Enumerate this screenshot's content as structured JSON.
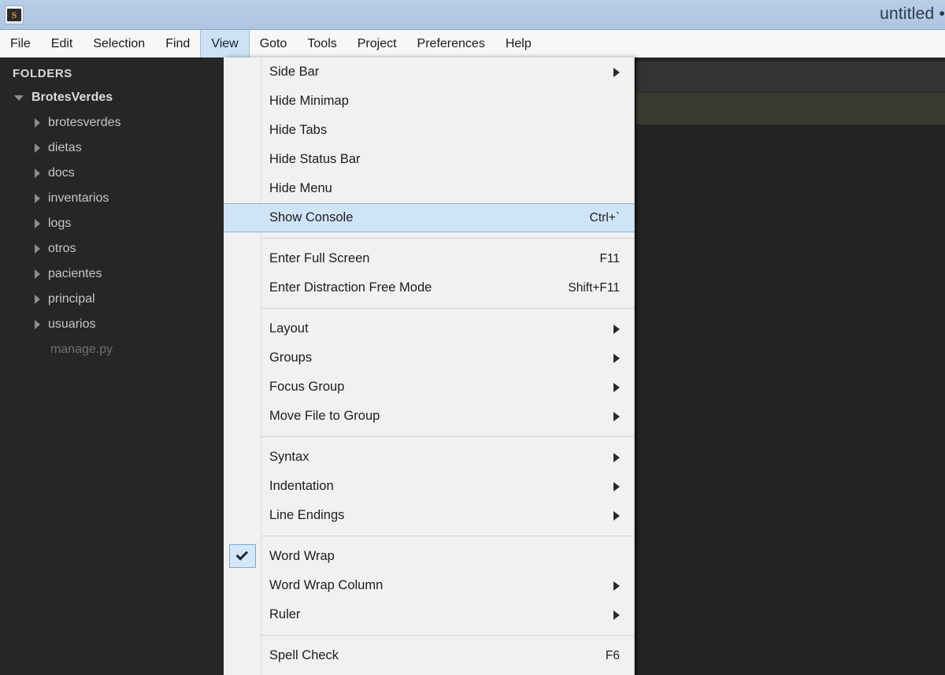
{
  "window": {
    "title": "untitled •",
    "app_icon": "sublime-text-icon",
    "icon_letter": "S"
  },
  "menubar": {
    "items": [
      {
        "label": "File",
        "active": false
      },
      {
        "label": "Edit",
        "active": false
      },
      {
        "label": "Selection",
        "active": false
      },
      {
        "label": "Find",
        "active": false
      },
      {
        "label": "View",
        "active": true
      },
      {
        "label": "Goto",
        "active": false
      },
      {
        "label": "Tools",
        "active": false
      },
      {
        "label": "Project",
        "active": false
      },
      {
        "label": "Preferences",
        "active": false
      },
      {
        "label": "Help",
        "active": false
      }
    ]
  },
  "sidebar": {
    "header": "FOLDERS",
    "root": {
      "label": "BrotesVerdes",
      "expanded": true
    },
    "folders": [
      {
        "label": "brotesverdes"
      },
      {
        "label": "dietas"
      },
      {
        "label": "docs"
      },
      {
        "label": "inventarios"
      },
      {
        "label": "logs"
      },
      {
        "label": "otros"
      },
      {
        "label": "pacientes"
      },
      {
        "label": "principal"
      },
      {
        "label": "usuarios"
      }
    ],
    "files": [
      {
        "label": "manage.py"
      }
    ]
  },
  "view_menu": {
    "groups": [
      {
        "items": [
          {
            "label": "Side Bar",
            "shortcut": "",
            "submenu": true,
            "selected": false,
            "checked": false
          },
          {
            "label": "Hide Minimap",
            "shortcut": "",
            "submenu": false,
            "selected": false,
            "checked": false
          },
          {
            "label": "Hide Tabs",
            "shortcut": "",
            "submenu": false,
            "selected": false,
            "checked": false
          },
          {
            "label": "Hide Status Bar",
            "shortcut": "",
            "submenu": false,
            "selected": false,
            "checked": false
          },
          {
            "label": "Hide Menu",
            "shortcut": "",
            "submenu": false,
            "selected": false,
            "checked": false
          },
          {
            "label": "Show Console",
            "shortcut": "Ctrl+`",
            "submenu": false,
            "selected": true,
            "checked": false
          }
        ]
      },
      {
        "items": [
          {
            "label": "Enter Full Screen",
            "shortcut": "F11",
            "submenu": false,
            "selected": false,
            "checked": false
          },
          {
            "label": "Enter Distraction Free Mode",
            "shortcut": "Shift+F11",
            "submenu": false,
            "selected": false,
            "checked": false
          }
        ]
      },
      {
        "items": [
          {
            "label": "Layout",
            "shortcut": "",
            "submenu": true,
            "selected": false,
            "checked": false
          },
          {
            "label": "Groups",
            "shortcut": "",
            "submenu": true,
            "selected": false,
            "checked": false
          },
          {
            "label": "Focus Group",
            "shortcut": "",
            "submenu": true,
            "selected": false,
            "checked": false
          },
          {
            "label": "Move File to Group",
            "shortcut": "",
            "submenu": true,
            "selected": false,
            "checked": false
          }
        ]
      },
      {
        "items": [
          {
            "label": "Syntax",
            "shortcut": "",
            "submenu": true,
            "selected": false,
            "checked": false
          },
          {
            "label": "Indentation",
            "shortcut": "",
            "submenu": true,
            "selected": false,
            "checked": false
          },
          {
            "label": "Line Endings",
            "shortcut": "",
            "submenu": true,
            "selected": false,
            "checked": false
          }
        ]
      },
      {
        "items": [
          {
            "label": "Word Wrap",
            "shortcut": "",
            "submenu": false,
            "selected": false,
            "checked": true
          },
          {
            "label": "Word Wrap Column",
            "shortcut": "",
            "submenu": true,
            "selected": false,
            "checked": false
          },
          {
            "label": "Ruler",
            "shortcut": "",
            "submenu": true,
            "selected": false,
            "checked": false
          }
        ]
      },
      {
        "items": [
          {
            "label": "Spell Check",
            "shortcut": "F6",
            "submenu": false,
            "selected": false,
            "checked": false
          }
        ]
      }
    ]
  },
  "colors": {
    "titlebar": "#b2c9e4",
    "menubar": "#f7f7f7",
    "menu_highlight": "#cfe4f7",
    "menu_bg": "#f1f1f1",
    "sidebar_bg": "#262626",
    "editor_bg": "#232323",
    "current_line": "#3b3b2f",
    "accent_border": "#8ab4dc"
  }
}
